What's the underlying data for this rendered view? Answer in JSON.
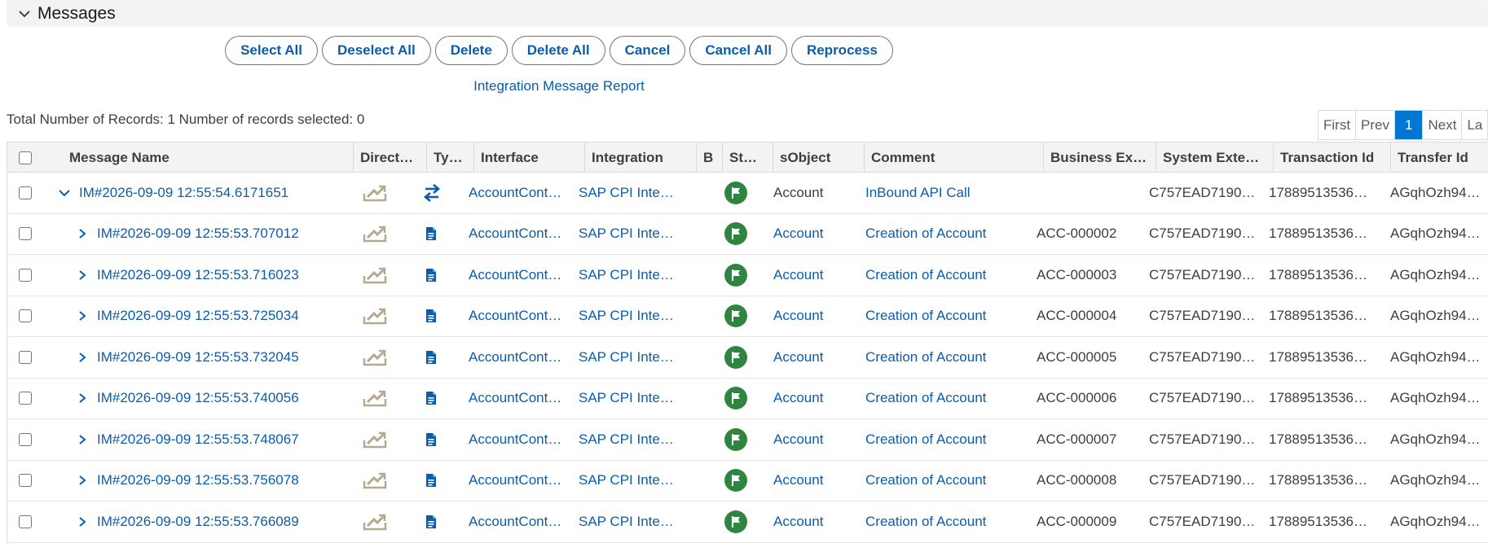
{
  "section": {
    "title": "Messages"
  },
  "toolbar": {
    "select_all": "Select All",
    "deselect_all": "Deselect All",
    "delete": "Delete",
    "delete_all": "Delete All",
    "cancel": "Cancel",
    "cancel_all": "Cancel All",
    "reprocess": "Reprocess"
  },
  "report_link": "Integration Message Report",
  "records_info": "Total Number of Records: 1 Number of records selected: 0",
  "pager": {
    "first": "First",
    "prev": "Prev",
    "page": "1",
    "next": "Next",
    "last": "La"
  },
  "columns": {
    "message_name": "Message Name",
    "direction": "Direct…",
    "type": "Ty…",
    "interface": "Interface",
    "integration": "Integration",
    "b": "B",
    "status": "St…",
    "sobject": "sObject",
    "comment": "Comment",
    "business_ext": "Business Ex…",
    "system_ext": "System Exte…",
    "transaction_id": "Transaction Id",
    "transfer_id": "Transfer Id"
  },
  "rows": [
    {
      "name": "IM#2026-09-09 12:55:54.6171651",
      "expanded": true,
      "level": 0,
      "type": "transfer",
      "interface": "AccountCont…",
      "integration": "SAP CPI Inte…",
      "sobject": "Account",
      "sobject_link": false,
      "comment": "InBound API Call",
      "business_ext": "",
      "system_ext": "C757EAD7190…",
      "transaction_id": "17889513536…",
      "transfer_id": "AGqhOzh94…"
    },
    {
      "name": "IM#2026-09-09 12:55:53.707012",
      "expanded": false,
      "level": 1,
      "type": "doc",
      "interface": "AccountCont…",
      "integration": "SAP CPI Inte…",
      "sobject": "Account",
      "sobject_link": true,
      "comment": "Creation of Account",
      "business_ext": "ACC-000002",
      "system_ext": "C757EAD7190…",
      "transaction_id": "17889513536…",
      "transfer_id": "AGqhOzh94…"
    },
    {
      "name": "IM#2026-09-09 12:55:53.716023",
      "expanded": false,
      "level": 1,
      "type": "doc",
      "interface": "AccountCont…",
      "integration": "SAP CPI Inte…",
      "sobject": "Account",
      "sobject_link": true,
      "comment": "Creation of Account",
      "business_ext": "ACC-000003",
      "system_ext": "C757EAD7190…",
      "transaction_id": "17889513536…",
      "transfer_id": "AGqhOzh94…"
    },
    {
      "name": "IM#2026-09-09 12:55:53.725034",
      "expanded": false,
      "level": 1,
      "type": "doc",
      "interface": "AccountCont…",
      "integration": "SAP CPI Inte…",
      "sobject": "Account",
      "sobject_link": true,
      "comment": "Creation of Account",
      "business_ext": "ACC-000004",
      "system_ext": "C757EAD7190…",
      "transaction_id": "17889513536…",
      "transfer_id": "AGqhOzh94…"
    },
    {
      "name": "IM#2026-09-09 12:55:53.732045",
      "expanded": false,
      "level": 1,
      "type": "doc",
      "interface": "AccountCont…",
      "integration": "SAP CPI Inte…",
      "sobject": "Account",
      "sobject_link": true,
      "comment": "Creation of Account",
      "business_ext": "ACC-000005",
      "system_ext": "C757EAD7190…",
      "transaction_id": "17889513536…",
      "transfer_id": "AGqhOzh94…"
    },
    {
      "name": "IM#2026-09-09 12:55:53.740056",
      "expanded": false,
      "level": 1,
      "type": "doc",
      "interface": "AccountCont…",
      "integration": "SAP CPI Inte…",
      "sobject": "Account",
      "sobject_link": true,
      "comment": "Creation of Account",
      "business_ext": "ACC-000006",
      "system_ext": "C757EAD7190…",
      "transaction_id": "17889513536…",
      "transfer_id": "AGqhOzh94…"
    },
    {
      "name": "IM#2026-09-09 12:55:53.748067",
      "expanded": false,
      "level": 1,
      "type": "doc",
      "interface": "AccountCont…",
      "integration": "SAP CPI Inte…",
      "sobject": "Account",
      "sobject_link": true,
      "comment": "Creation of Account",
      "business_ext": "ACC-000007",
      "system_ext": "C757EAD7190…",
      "transaction_id": "17889513536…",
      "transfer_id": "AGqhOzh94…"
    },
    {
      "name": "IM#2026-09-09 12:55:53.756078",
      "expanded": false,
      "level": 1,
      "type": "doc",
      "interface": "AccountCont…",
      "integration": "SAP CPI Inte…",
      "sobject": "Account",
      "sobject_link": true,
      "comment": "Creation of Account",
      "business_ext": "ACC-000008",
      "system_ext": "C757EAD7190…",
      "transaction_id": "17889513536…",
      "transfer_id": "AGqhOzh94…"
    },
    {
      "name": "IM#2026-09-09 12:55:53.766089",
      "expanded": false,
      "level": 1,
      "type": "doc",
      "interface": "AccountCont…",
      "integration": "SAP CPI Inte…",
      "sobject": "Account",
      "sobject_link": true,
      "comment": "Creation of Account",
      "business_ext": "ACC-000009",
      "system_ext": "C757EAD7190…",
      "transaction_id": "17889513536…",
      "transfer_id": "AGqhOzh94…"
    }
  ],
  "icons": {
    "section_toggle": "chevron-down-icon",
    "direction": "inbound-tray-icon",
    "type_parent": "transfer-arrows-icon",
    "type_child": "document-icon",
    "status": "flag-icon"
  },
  "colors": {
    "link": "#0b5cab",
    "status_success": "#2e8540",
    "pager_active": "#0176d3"
  }
}
